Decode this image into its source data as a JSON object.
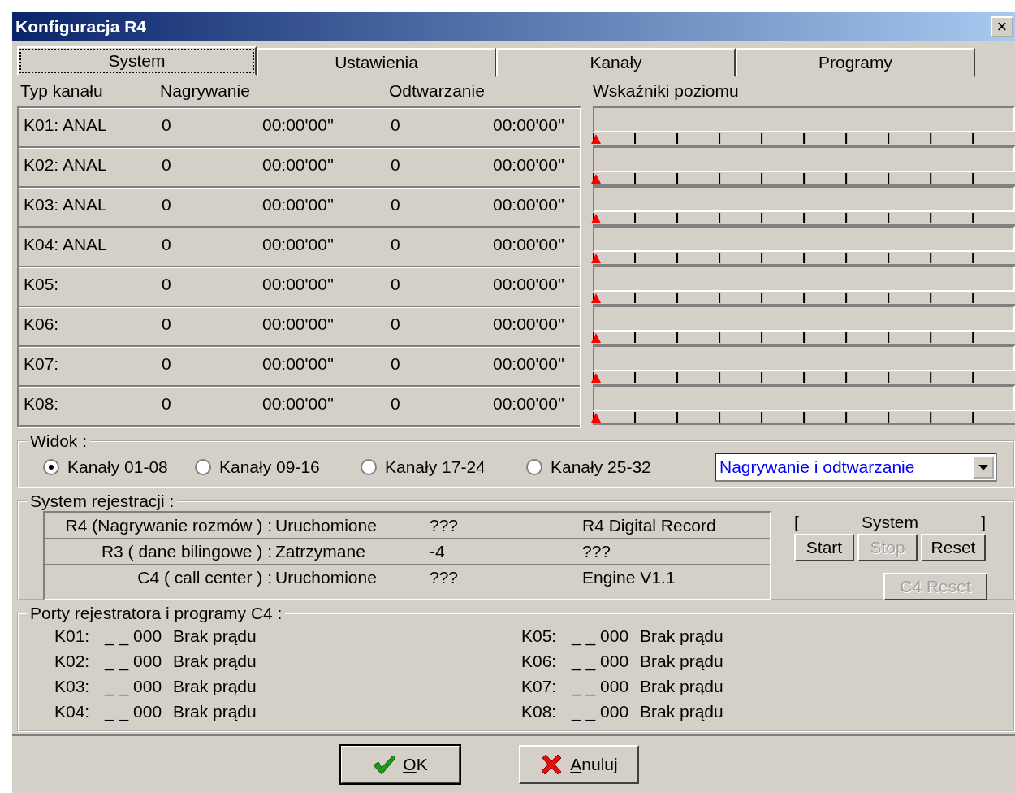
{
  "window": {
    "title": "Konfiguracja R4",
    "close": "×"
  },
  "tabs": [
    {
      "label": "System",
      "selected": true
    },
    {
      "label": "Ustawienia",
      "selected": false
    },
    {
      "label": "Kanały",
      "selected": false
    },
    {
      "label": "Programy",
      "selected": false
    }
  ],
  "channel_headers": {
    "type": "Typ kanału",
    "recording": "Nagrywanie",
    "playback": "Odtwarzanie",
    "meters": "Wskaźniki poziomu"
  },
  "channels": [
    {
      "name": "K01: ANAL",
      "rec_count": "0",
      "rec_time": "00:00'00''",
      "play_count": "0",
      "play_time": "00:00'00''"
    },
    {
      "name": "K02: ANAL",
      "rec_count": "0",
      "rec_time": "00:00'00''",
      "play_count": "0",
      "play_time": "00:00'00''"
    },
    {
      "name": "K03: ANAL",
      "rec_count": "0",
      "rec_time": "00:00'00''",
      "play_count": "0",
      "play_time": "00:00'00''"
    },
    {
      "name": "K04: ANAL",
      "rec_count": "0",
      "rec_time": "00:00'00''",
      "play_count": "0",
      "play_time": "00:00'00''"
    },
    {
      "name": "K05:",
      "rec_count": "0",
      "rec_time": "00:00'00''",
      "play_count": "0",
      "play_time": "00:00'00''"
    },
    {
      "name": "K06:",
      "rec_count": "0",
      "rec_time": "00:00'00''",
      "play_count": "0",
      "play_time": "00:00'00''"
    },
    {
      "name": "K07:",
      "rec_count": "0",
      "rec_time": "00:00'00''",
      "play_count": "0",
      "play_time": "00:00'00''"
    },
    {
      "name": "K08:",
      "rec_count": "0",
      "rec_time": "00:00'00''",
      "play_count": "0",
      "play_time": "00:00'00''"
    }
  ],
  "view": {
    "title": "Widok :",
    "options": [
      {
        "label": "Kanały 01-08",
        "selected": true
      },
      {
        "label": "Kanały 09-16",
        "selected": false
      },
      {
        "label": "Kanały 17-24",
        "selected": false
      },
      {
        "label": "Kanały 25-32",
        "selected": false
      }
    ],
    "dropdown": {
      "value": "Nagrywanie i odtwarzanie"
    }
  },
  "registration": {
    "title": "System rejestracji :",
    "rows": [
      {
        "label": "R4 (Nagrywanie rozmów ) :",
        "state": "Uruchomione",
        "code": "???",
        "info": "R4 Digital Record"
      },
      {
        "label": "R3 ( dane bilingowe ) :",
        "state": "Zatrzymane",
        "code": "-4",
        "info": "???"
      },
      {
        "label": "C4 ( call center ) :",
        "state": "Uruchomione",
        "code": "???",
        "info": "Engine V1.1"
      }
    ],
    "system_label": {
      "left": "[",
      "text": "System",
      "right": "]"
    },
    "buttons": [
      {
        "label": "Start",
        "disabled": false
      },
      {
        "label": "Stop",
        "disabled": true
      },
      {
        "label": "Reset",
        "disabled": false
      }
    ],
    "c4_reset": {
      "label": "C4 Reset",
      "disabled": true
    }
  },
  "ports": {
    "title": "Porty rejestratora i programy C4 :",
    "items": [
      {
        "name": "K01:",
        "code": "_ _ 000",
        "status": "Brak prądu"
      },
      {
        "name": "K02:",
        "code": "_ _ 000",
        "status": "Brak prądu"
      },
      {
        "name": "K03:",
        "code": "_ _ 000",
        "status": "Brak prądu"
      },
      {
        "name": "K04:",
        "code": "_ _ 000",
        "status": "Brak prądu"
      },
      {
        "name": "K05:",
        "code": "_ _ 000",
        "status": "Brak prądu"
      },
      {
        "name": "K06:",
        "code": "_ _ 000",
        "status": "Brak prądu"
      },
      {
        "name": "K07:",
        "code": "_ _ 000",
        "status": "Brak prądu"
      },
      {
        "name": "K08:",
        "code": "_ _ 000",
        "status": "Brak prądu"
      }
    ]
  },
  "footer": [
    {
      "label": "OK",
      "kind": "ok",
      "default": true
    },
    {
      "label": "Anuluj",
      "kind": "cancel",
      "default": false
    }
  ]
}
